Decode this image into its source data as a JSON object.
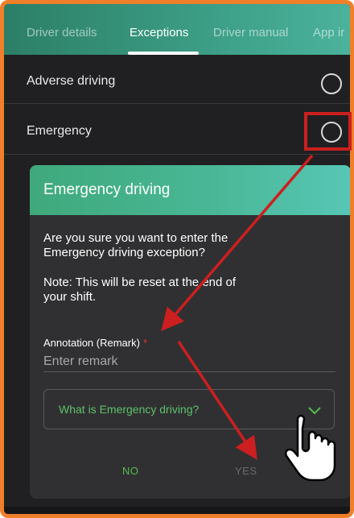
{
  "tabs": [
    {
      "label": "Driver details",
      "active": false
    },
    {
      "label": "Exceptions",
      "active": true
    },
    {
      "label": "Driver manual",
      "active": false
    },
    {
      "label": "App ir",
      "active": false
    }
  ],
  "rows": [
    {
      "label": "Adverse driving",
      "selected": false
    },
    {
      "label": "Emergency",
      "selected": false
    }
  ],
  "dialog": {
    "title": "Emergency driving",
    "message_line1": "Are you sure you want to enter the",
    "message_line2": "Emergency driving exception?",
    "note_line1": "Note: This will be reset at the end of",
    "note_line2": "your shift.",
    "annotation_label": "Annotation (Remark)",
    "required_mark": "*",
    "remark_placeholder": "Enter remark",
    "expander_label": "What is Emergency driving?",
    "no_label": "NO",
    "yes_label": "YES"
  },
  "colors": {
    "frame_border": "#f07f2a",
    "annotation_red": "#cc1f1f",
    "accent_green": "#55bf4d"
  },
  "icons": {
    "radio": "radio-unchecked-icon",
    "chevron": "chevron-down-icon",
    "cursor": "hand-pointer-icon"
  }
}
